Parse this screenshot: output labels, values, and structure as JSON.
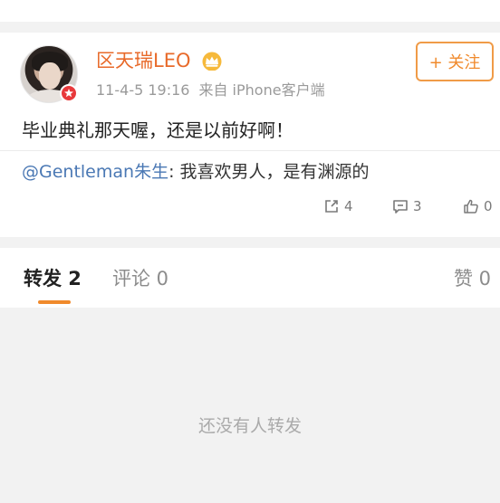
{
  "post": {
    "author": "区天瑞LEO",
    "time": "11-4-5 19:16",
    "source": "来自 iPhone客户端",
    "follow_label": "+ 关注",
    "text": "毕业典礼那天喔，还是以前好啊！",
    "repost": {
      "mention": "@Gentleman朱生",
      "text": ": 我喜欢男人，是有渊源的"
    },
    "counts": {
      "share": "4",
      "comment": "3",
      "like": "0"
    }
  },
  "tabs": {
    "repost": "转发 2",
    "comment": "评论 0",
    "like": "赞 0"
  },
  "empty_message": "还没有人转发",
  "colors": {
    "username": "#e86a2a",
    "accent": "#f08a2c",
    "mention": "#4a78b4",
    "verify_badge": "#e8393b"
  },
  "icons": [
    "verified-badge-icon",
    "crown-icon",
    "share-icon",
    "comment-icon",
    "like-icon"
  ]
}
